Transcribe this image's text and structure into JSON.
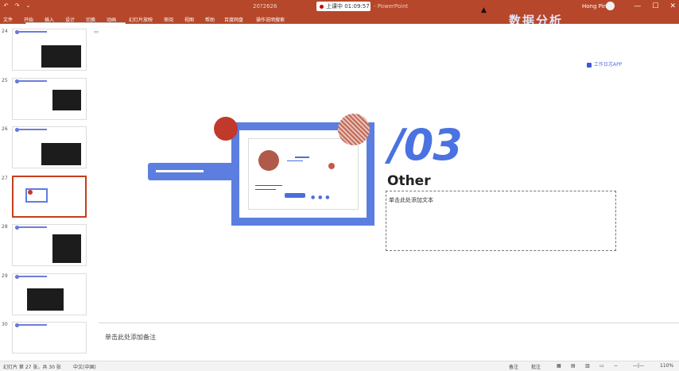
{
  "app": {
    "title": "20?2626",
    "rec_label": "上课中 01:09:57",
    "ext_label": "- PowerPoint",
    "user": "Hong Ping"
  },
  "window": {
    "minimize": "—",
    "maximize": "☐",
    "close": "✕"
  },
  "quick_access": [
    "↶",
    "↷",
    "⌄"
  ],
  "ribbon_tabs": [
    "文件",
    "开始",
    "插入",
    "设计",
    "切换",
    "动画",
    "幻灯片放映",
    "审阅",
    "视图",
    "帮助",
    "百度网盘",
    "操作说明搜索"
  ],
  "ribbon_watermark": "数据分析",
  "float_toolbar": [
    "⌂",
    "✎",
    "▭",
    "—",
    "◇",
    "◯",
    "▣"
  ],
  "thumbnails": [
    {
      "num": "24",
      "kind": "shot"
    },
    {
      "num": "25",
      "kind": "shot"
    },
    {
      "num": "26",
      "kind": "shot"
    },
    {
      "num": "27",
      "kind": "section",
      "selected": true
    },
    {
      "num": "28",
      "kind": "shot"
    },
    {
      "num": "29",
      "kind": "shot"
    },
    {
      "num": "30",
      "kind": "plain"
    }
  ],
  "slide": {
    "brand": "工作日志APP",
    "number": "/03",
    "title": "Other",
    "body_text": "单击此处添加文本"
  },
  "notes_placeholder": "单击此处添加备注",
  "status": {
    "left": "幻灯片 第 27 张，共 30 张",
    "lang": "中文(中国)",
    "notes_btn": "备注",
    "comments_btn": "批注",
    "zoom": "110%"
  },
  "colors": {
    "accent": "#b7472a",
    "slide_blue": "#5b7ee0",
    "slide_red": "#c0392b"
  }
}
